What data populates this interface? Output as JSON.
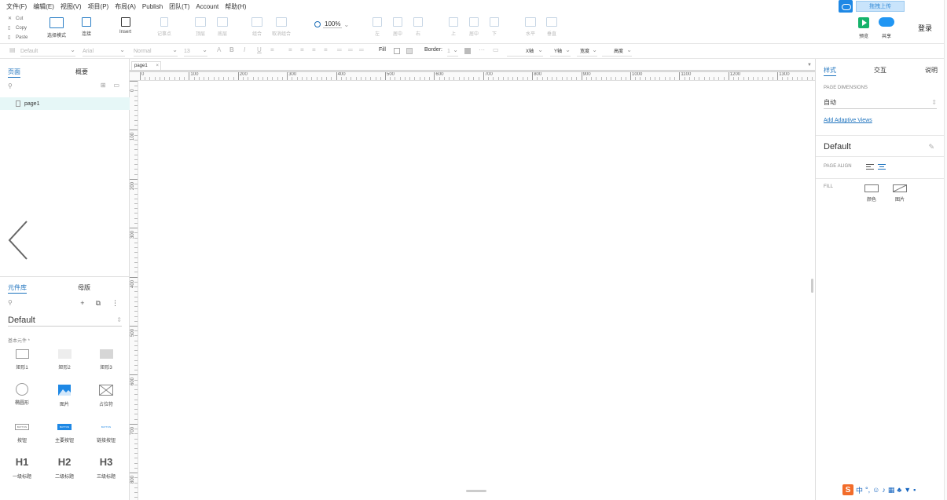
{
  "menu": [
    "文件(F)",
    "编辑(E)",
    "视图(V)",
    "项目(P)",
    "布局(A)",
    "Publish",
    "团队(T)",
    "Account",
    "帮助(H)"
  ],
  "cloud_upload_label": "拖拽上传",
  "clipboard": {
    "cut": "Cut",
    "copy": "Copy",
    "paste": "Paste"
  },
  "toolbar": {
    "select_mode": "选择模式",
    "connect": "连接",
    "insert": "Insert",
    "point": "记事点",
    "top": "顶层",
    "bottom": "底层",
    "group": "组合",
    "ungroup": "取消组合",
    "left": "左",
    "center": "居中",
    "right": "右",
    "top_align": "上",
    "middle": "居中",
    "bottom_align": "下",
    "h_distribute": "水平",
    "v_distribute": "垂直",
    "zoom": "100%",
    "preview": "预览",
    "share": "共享",
    "login": "登录"
  },
  "format": {
    "style": "Default",
    "font": "Arial",
    "weight": "Normal",
    "size": "13",
    "fill": "Fill",
    "border": "Border:",
    "border_w": "1",
    "x": "X轴",
    "y": "Y轴",
    "w": "宽度",
    "h": "高度"
  },
  "left": {
    "tab_pages": "页面",
    "tab_outline": "概要",
    "page_name": "page1",
    "tab_library": "元件库",
    "tab_masters": "母版",
    "library_select": "Default",
    "section": "基本元件 *",
    "widgets": [
      {
        "label": "矩形1"
      },
      {
        "label": "矩形2"
      },
      {
        "label": "矩形3"
      },
      {
        "label": "椭圆形"
      },
      {
        "label": "图片"
      },
      {
        "label": "占位符"
      },
      {
        "label": "按钮",
        "text": "BUTTON"
      },
      {
        "label": "主要按钮",
        "text": "BUTTON"
      },
      {
        "label": "链接按钮",
        "text": "BUTTON"
      },
      {
        "label": "一级标题",
        "text": "H1"
      },
      {
        "label": "二级标题",
        "text": "H2"
      },
      {
        "label": "三级标题",
        "text": "H3"
      }
    ]
  },
  "canvas": {
    "tab": "page1",
    "h_ticks": [
      "0",
      "100",
      "200",
      "300",
      "400",
      "500",
      "600",
      "700",
      "800",
      "900",
      "1000",
      "1100",
      "1200",
      "1300"
    ],
    "v_ticks": [
      "0",
      "100",
      "200",
      "300",
      "400",
      "500",
      "600",
      "700",
      "800"
    ]
  },
  "right": {
    "tab_style": "样式",
    "tab_interact": "交互",
    "tab_notes": "说明",
    "page_dimensions": "PAGE DIMENSIONS",
    "dimension_value": "自动",
    "adaptive": "Add Adaptive Views",
    "default": "Default",
    "page_align": "PAGE ALIGN",
    "fill": "FILL",
    "fill_color": "颜色",
    "fill_image": "图片"
  },
  "ime": "中"
}
